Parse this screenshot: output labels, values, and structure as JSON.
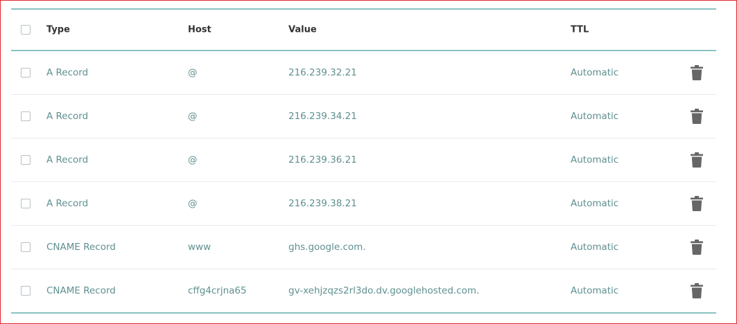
{
  "columns": {
    "type": "Type",
    "host": "Host",
    "value": "Value",
    "ttl": "TTL"
  },
  "records": [
    {
      "type": "A Record",
      "host": "@",
      "value": "216.239.32.21",
      "ttl": "Automatic"
    },
    {
      "type": "A Record",
      "host": "@",
      "value": "216.239.34.21",
      "ttl": "Automatic"
    },
    {
      "type": "A Record",
      "host": "@",
      "value": "216.239.36.21",
      "ttl": "Automatic"
    },
    {
      "type": "A Record",
      "host": "@",
      "value": "216.239.38.21",
      "ttl": "Automatic"
    },
    {
      "type": "CNAME Record",
      "host": "www",
      "value": "ghs.google.com.",
      "ttl": "Automatic"
    },
    {
      "type": "CNAME Record",
      "host": "cffg4crjna65",
      "value": "gv-xehjzqzs2rl3do.dv.googlehosted.com.",
      "ttl": "Automatic"
    }
  ],
  "icons": {
    "delete": "trash-icon"
  },
  "colors": {
    "accent_border": "#89c2c0",
    "row_text": "#5f8f90",
    "header_text": "#333333",
    "trash": "#666666",
    "frame": "#e3262b"
  }
}
